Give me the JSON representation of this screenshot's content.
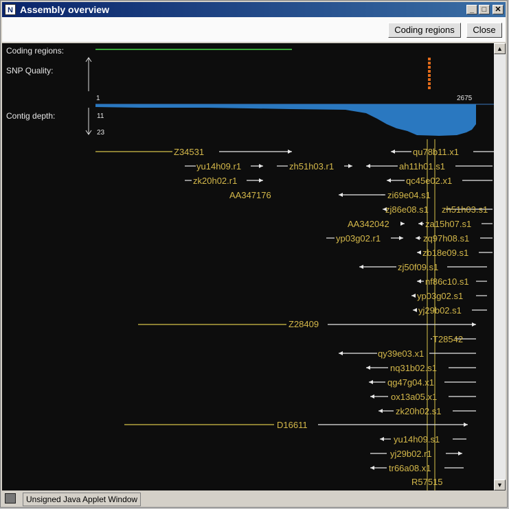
{
  "window": {
    "title": "Assembly overview",
    "minimize": "_",
    "maximize": "□",
    "close": "✕"
  },
  "toolbar": {
    "coding_regions_label": "Coding regions",
    "close_label": "Close"
  },
  "panel": {
    "coding_regions_label": "Coding regions:",
    "snp_quality_label": "SNP Quality:",
    "contig_depth_label": "Contig depth:",
    "axis_start": "1",
    "axis_end": "2675",
    "depth_mid": "11",
    "depth_max": "23"
  },
  "reads": [
    {
      "id": "Z34531"
    },
    {
      "id": "qu78b11.x1"
    },
    {
      "id": "yu14h09.r1"
    },
    {
      "id": "zh51h03.r1"
    },
    {
      "id": "ah11h01.s1"
    },
    {
      "id": "zk20h02.r1"
    },
    {
      "id": "qc45e02.x1"
    },
    {
      "id": "AA347176"
    },
    {
      "id": "zi69e04.s1"
    },
    {
      "id": "zj86e08.s1"
    },
    {
      "id": "zh51h03.s1"
    },
    {
      "id": "AA342042"
    },
    {
      "id": "za15h07.s1"
    },
    {
      "id": "yp03g02.r1"
    },
    {
      "id": "zq97h08.s1"
    },
    {
      "id": "zb18e09.s1"
    },
    {
      "id": "zj50f09.s1"
    },
    {
      "id": "nf86c10.s1"
    },
    {
      "id": "yp03g02.s1"
    },
    {
      "id": "yj29b02.s1"
    },
    {
      "id": "Z28409"
    },
    {
      "id": "T28542"
    },
    {
      "id": "qy39e03.x1"
    },
    {
      "id": "nq31b02.s1"
    },
    {
      "id": "qg47g04.x1"
    },
    {
      "id": "ox13a05.x1"
    },
    {
      "id": "zk20h02.s1"
    },
    {
      "id": "D16611"
    },
    {
      "id": "yu14h09.s1"
    },
    {
      "id": "yj29b02.r1"
    },
    {
      "id": "tr66a08.x1"
    },
    {
      "id": "R57515"
    }
  ],
  "statusbar": {
    "text": "Unsigned Java Applet Window"
  },
  "colors": {
    "read_label": "#d4b84a",
    "arrow": "#e8e8e8",
    "coding": "#3aa83a",
    "snp": "#e06a1a",
    "depth": "#2a78c0",
    "canvas": "#0d0d0d"
  }
}
